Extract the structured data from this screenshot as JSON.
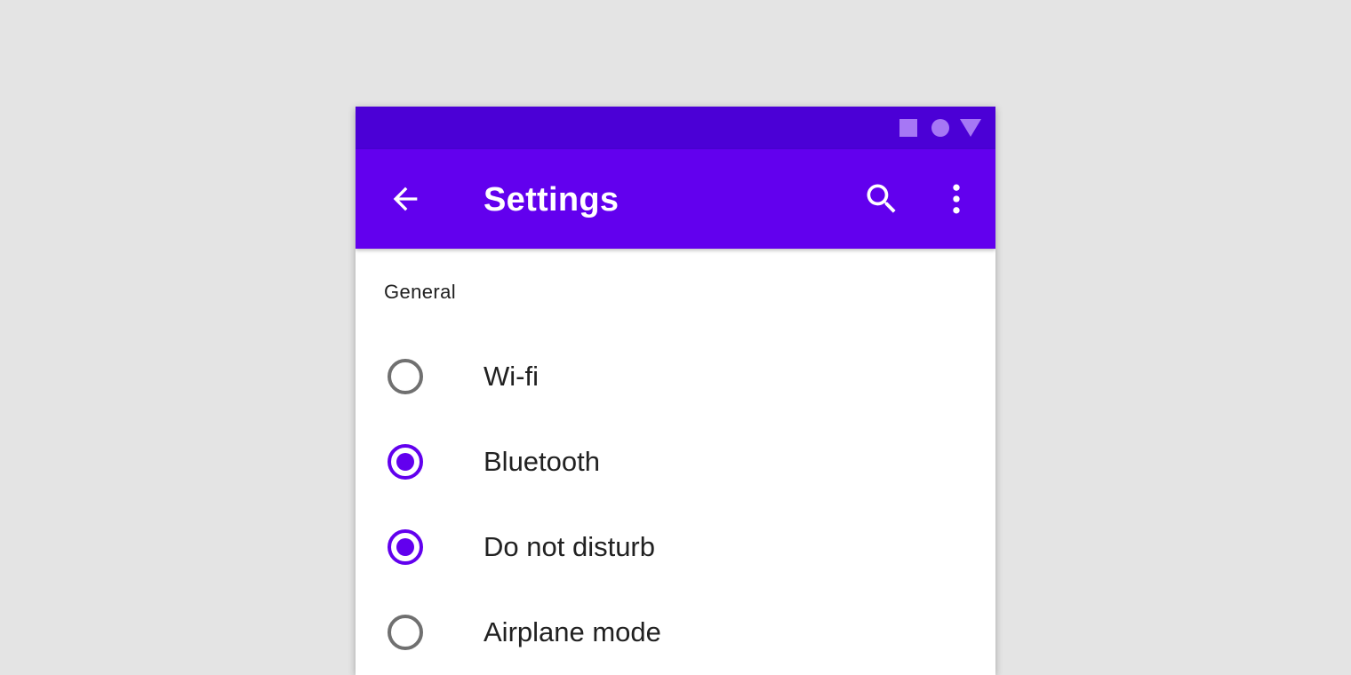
{
  "colors": {
    "background": "#e4e4e4",
    "status_bar": "#4b00d6",
    "app_bar": "#6200ee",
    "status_icon": "#a677f5",
    "radio_checked": "#6200ee",
    "radio_unchecked": "#707070",
    "text": "#212121"
  },
  "status_bar": {
    "icons": [
      "square-icon",
      "circle-icon",
      "triangle-icon"
    ]
  },
  "app_bar": {
    "title": "Settings",
    "back_icon": "arrow-back-icon",
    "search_icon": "search-icon",
    "more_icon": "more-vert-icon"
  },
  "section": {
    "header": "General"
  },
  "options": [
    {
      "label": "Wi-fi",
      "checked": false
    },
    {
      "label": "Bluetooth",
      "checked": true
    },
    {
      "label": "Do not disturb",
      "checked": true
    },
    {
      "label": "Airplane mode",
      "checked": false
    }
  ]
}
